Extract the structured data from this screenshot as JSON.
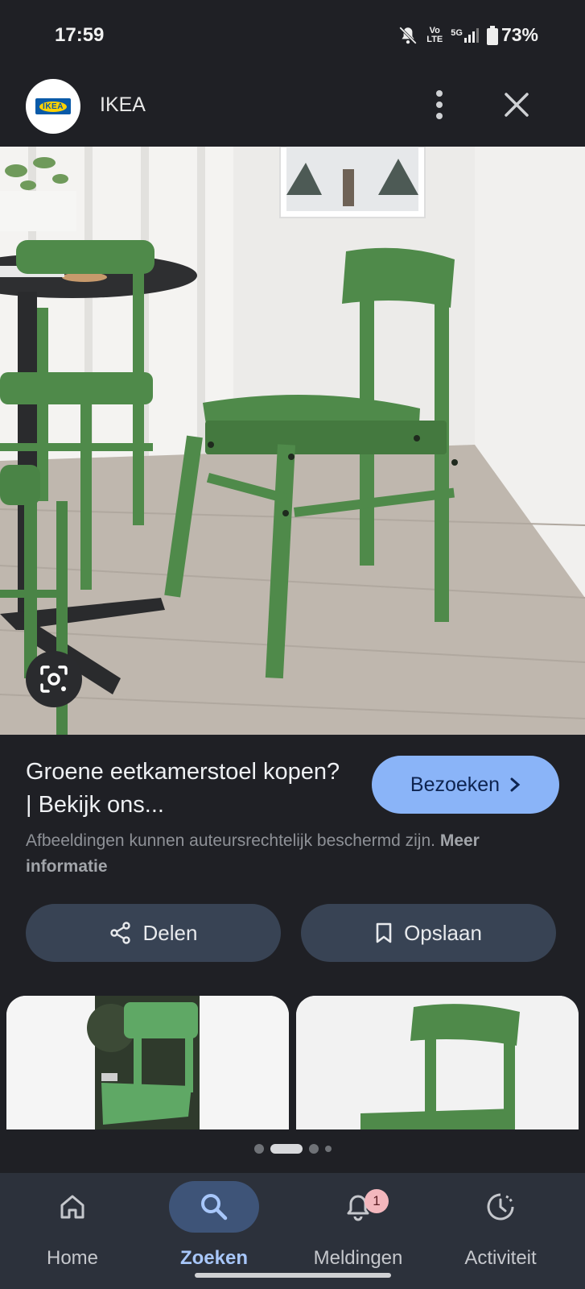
{
  "status": {
    "time": "17:59",
    "network_top": "Vo",
    "network_bottom": "LTE",
    "signal": "5G",
    "battery": "73%"
  },
  "header": {
    "site_name": "IKEA",
    "logo_text": "IKEA"
  },
  "result": {
    "title": "Groene eetkamerstoel kopen? | Bekijk ons...",
    "visit_label": "Bezoeken",
    "copyright_text": "Afbeeldingen kunnen auteursrechtelijk beschermd zijn.",
    "more_info": "Meer informatie"
  },
  "actions": {
    "share_label": "Delen",
    "save_label": "Opslaan"
  },
  "bottom_nav": {
    "items": [
      {
        "label": "Home"
      },
      {
        "label": "Zoeken"
      },
      {
        "label": "Meldingen",
        "badge": "1"
      },
      {
        "label": "Activiteit"
      }
    ],
    "active": "Zoeken"
  },
  "colors": {
    "background": "#1f2025",
    "accent": "#8ab4f8",
    "button": "#384354",
    "chair_green": "#4f8a4a"
  }
}
